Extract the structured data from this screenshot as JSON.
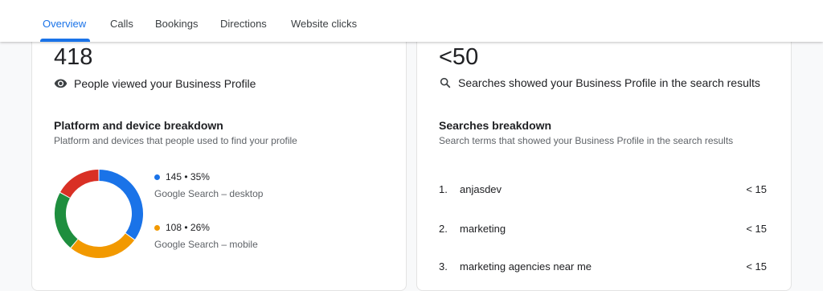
{
  "tabs": [
    {
      "label": "Overview",
      "active": true
    },
    {
      "label": "Calls",
      "active": false
    },
    {
      "label": "Bookings",
      "active": false
    },
    {
      "label": "Directions",
      "active": false
    },
    {
      "label": "Website clicks",
      "active": false
    }
  ],
  "left_card": {
    "big_number": "418",
    "metric_label": "People viewed your Business Profile",
    "section_title": "Platform and device breakdown",
    "section_subtitle": "Platform and devices that people used to find your profile",
    "legend": [
      {
        "value": "145 • 35%",
        "label": "Google Search – desktop",
        "color": "#1a73e8"
      },
      {
        "value": "108 • 26%",
        "label": "Google Search – mobile",
        "color": "#f29900"
      }
    ]
  },
  "chart_data": {
    "type": "pie",
    "style": "donut",
    "slices": [
      {
        "label": "Google Search – desktop",
        "value": 145,
        "percent": 35,
        "color": "#1a73e8"
      },
      {
        "label": "Google Search – mobile",
        "value": 108,
        "percent": 26,
        "color": "#f29900"
      },
      {
        "percent": 22,
        "color": "#1e8e3e"
      },
      {
        "percent": 17,
        "color": "#d93025"
      }
    ]
  },
  "right_card": {
    "big_number": "<50",
    "metric_label": "Searches showed your Business Profile in the search results",
    "section_title": "Searches breakdown",
    "section_subtitle": "Search terms that showed your Business Profile in the search results",
    "searches": [
      {
        "rank": "1.",
        "term": "anjasdev",
        "count": "< 15"
      },
      {
        "rank": "2.",
        "term": "marketing",
        "count": "< 15"
      },
      {
        "rank": "3.",
        "term": "marketing agencies near me",
        "count": "< 15"
      }
    ]
  },
  "icons": {
    "views": "eye-icon",
    "searches": "search-icon"
  }
}
